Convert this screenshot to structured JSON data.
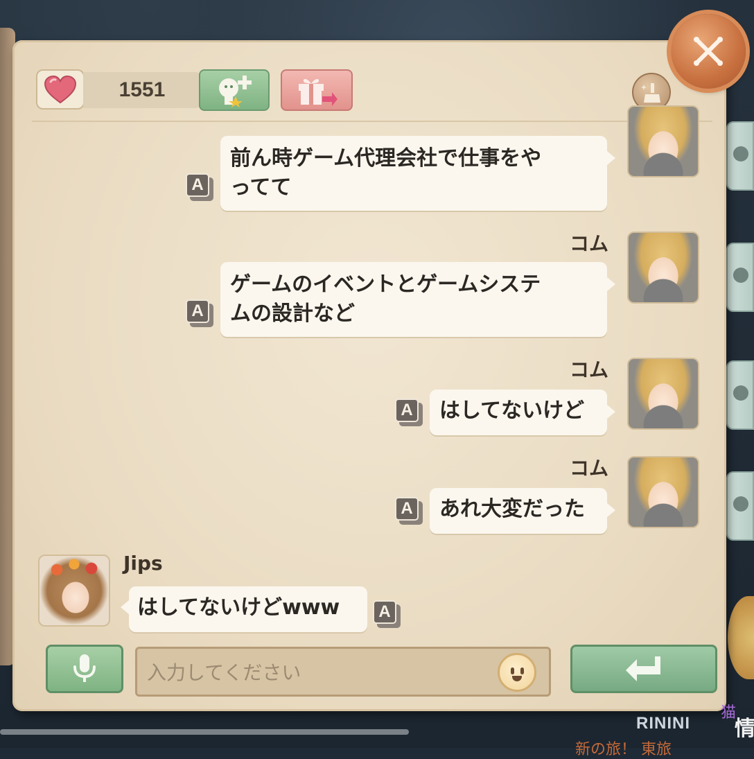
{
  "header": {
    "heart_count": "1551",
    "icons": [
      "heart-icon",
      "add-friend-icon",
      "gift-send-icon",
      "clean-icon",
      "close-icon"
    ]
  },
  "messages": [
    {
      "sender": "",
      "text": "前ん時ゲーム代理会社で仕事をや\nってて",
      "side": "right",
      "translate_label": "A"
    },
    {
      "sender": "コム",
      "text": "ゲームのイベントとゲームシステ\nムの設計など",
      "side": "right",
      "translate_label": "A"
    },
    {
      "sender": "コム",
      "text": "はしてないけど",
      "side": "right",
      "translate_label": "A"
    },
    {
      "sender": "コム",
      "text": "あれ大変だった",
      "side": "right",
      "translate_label": "A"
    },
    {
      "sender": "Jips",
      "text": "はしてないけどwww",
      "side": "left",
      "translate_label": "A"
    }
  ],
  "input": {
    "placeholder": "入力してください",
    "value": ""
  },
  "footer": {
    "player_name": "RININI",
    "kanji_main": "情",
    "kanji_small": "猫",
    "strip_text": "新の旅！ 東旅"
  },
  "colors": {
    "paper": "#eadcc3",
    "bubble": "#fbf7ee",
    "green_button": "#7fb383",
    "pink_button": "#e2928c",
    "close_button": "#c8703f"
  }
}
